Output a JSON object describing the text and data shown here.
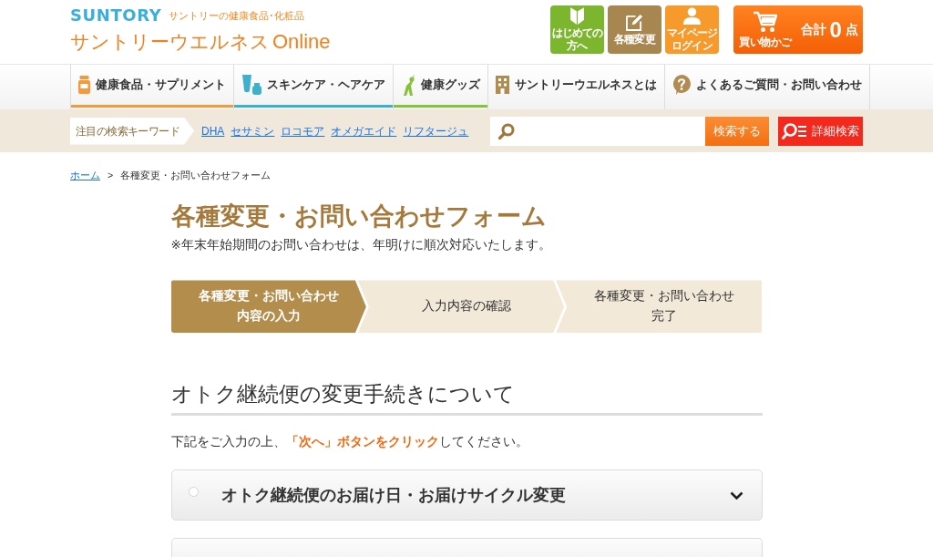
{
  "header": {
    "brand": "SUNTORY",
    "tagline": "サントリーの健康食品･化粧品",
    "site_name": "サントリーウエルネス",
    "site_name_suffix": "Online",
    "buttons": [
      {
        "kind": "beginner",
        "label": "はじめての方へ"
      },
      {
        "kind": "change",
        "label": "各種変更"
      },
      {
        "kind": "mypage",
        "label": "マイページログイン"
      }
    ],
    "cart": {
      "label": "買い物かご",
      "total_label": "合計",
      "count": "0",
      "unit": "点"
    }
  },
  "nav": [
    {
      "kind": "supplement",
      "label": "健康食品・サプリメント",
      "color": "#f39a3c"
    },
    {
      "kind": "skincare",
      "label": "スキンケア・ヘアケア",
      "color": "#3fb0cc"
    },
    {
      "kind": "goods",
      "label": "健康グッズ",
      "color": "#86c23a"
    },
    {
      "kind": "about",
      "label": "サントリーウエルネスとは"
    },
    {
      "kind": "faq",
      "label": "よくあるご質問・お問い合わせ"
    }
  ],
  "search": {
    "keywords_label": "注目の検索キーワード",
    "keywords": [
      "DHA",
      "セサミン",
      "ロコモア",
      "オメガエイド",
      "リフタージュ"
    ],
    "submit": "検索する",
    "advanced": "詳細検索"
  },
  "breadcrumb": {
    "items": [
      {
        "label": "ホーム",
        "link": true
      },
      {
        "label": "各種変更・お問い合わせフォーム",
        "link": false
      }
    ],
    "separator": ">"
  },
  "page": {
    "title": "各種変更・お問い合わせフォーム",
    "notice": "※年末年始期間のお問い合わせは、年明けに順次対応いたします。",
    "steps": [
      {
        "label": "各種変更・お問い合わせ内容の入力",
        "selected": true
      },
      {
        "label": "入力内容の確認",
        "selected": false
      },
      {
        "label": "各種変更・お問い合わせ完了",
        "selected": false
      }
    ],
    "section": {
      "heading": "オトク継続便の変更手続きについて",
      "instruction": "下記をご入力の上、**「次へ」ボタンをクリック**してください。",
      "options": [
        {
          "label": "オトク継続便のお届け日・お届けサイクル変更",
          "selected": false,
          "expanded": false
        }
      ],
      "more_options_below": true
    }
  }
}
